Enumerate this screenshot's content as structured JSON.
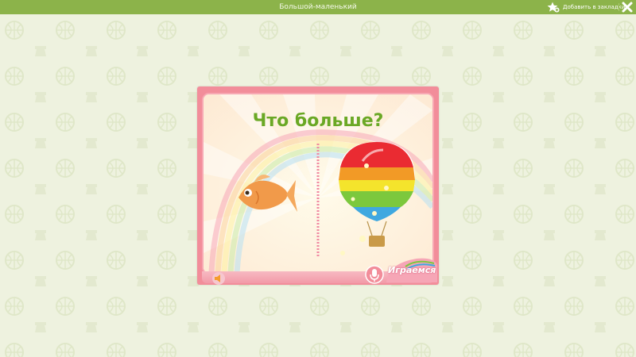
{
  "topbar": {
    "title": "Большой-маленький",
    "bookmark_label": "Добавить в закладки",
    "bookmark_icon": "star-plus-icon",
    "close_icon": "close-icon",
    "bar_color": "#8cb34a"
  },
  "game": {
    "question": "Что больше?",
    "left_object": "fish",
    "right_object": "hot-air-balloon",
    "logo_text": "Играемся",
    "sound_icon": "speaker-icon",
    "mic_icon": "microphone-icon",
    "question_color": "#6aa825",
    "frame_color": "#f28d9a"
  }
}
